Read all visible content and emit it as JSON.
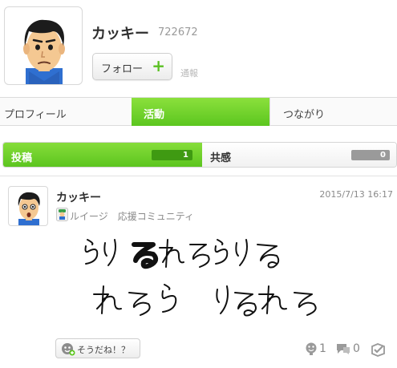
{
  "profile": {
    "name": "カッキー",
    "user_id": "722672",
    "follow_label": "フォロー",
    "follow_plus": "+",
    "report_label": "通報"
  },
  "tabs": [
    {
      "label": "プロフィール",
      "active": false
    },
    {
      "label": "活動",
      "active": true
    },
    {
      "label": "つながり",
      "active": false
    }
  ],
  "subtabs": [
    {
      "label": "投稿",
      "count": "1",
      "active": true
    },
    {
      "label": "共感",
      "count": "0",
      "active": false
    }
  ],
  "post": {
    "author": "カッキー",
    "date": "2015/7/13 16:17",
    "community": "ルイージ　応援コミュニティ",
    "drawing_text_line1": "らりるれろらりる",
    "drawing_text_line2": "れろら りるれろ",
    "yeah_label": "そうだね！？",
    "yeah_count": "1",
    "comment_count": "0"
  },
  "colors": {
    "accent_green": "#5cc61f",
    "count_green": "#3f9a12",
    "count_gray": "#9a9a9a"
  },
  "icons": [
    "plus-icon",
    "community-icon",
    "yeah-icon",
    "yeah-count-icon",
    "comment-icon",
    "spoiler-check-icon"
  ]
}
